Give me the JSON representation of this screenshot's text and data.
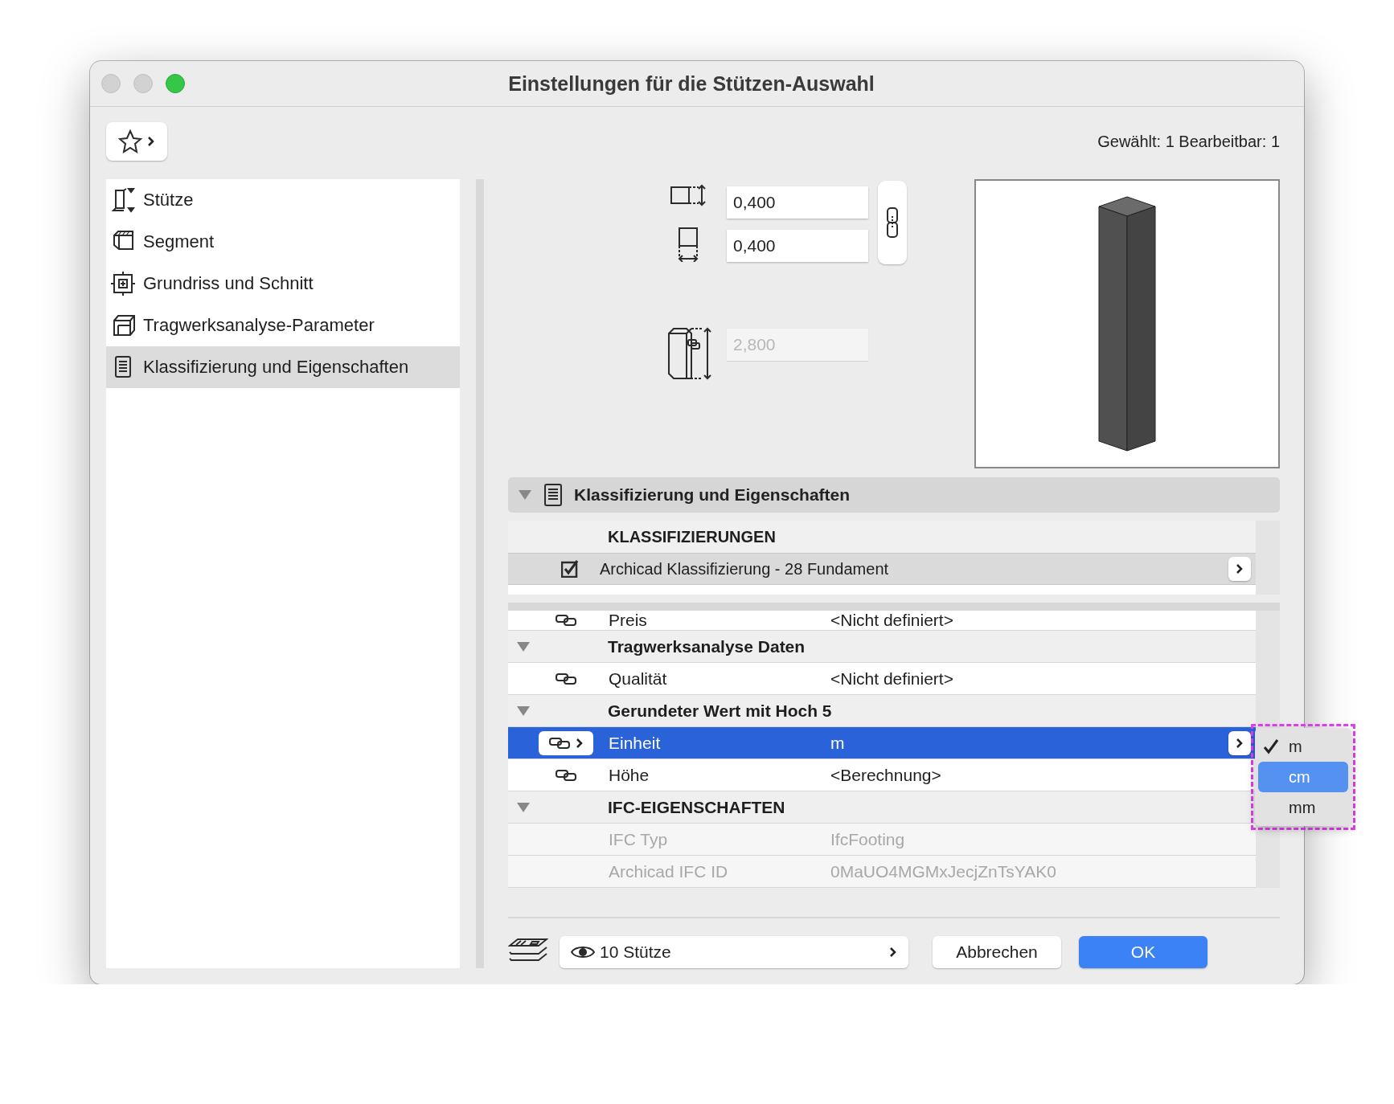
{
  "window": {
    "title": "Einstellungen für die Stützen-Auswahl"
  },
  "selection_info": "Gewählt: 1 Bearbeitbar: 1",
  "sidebar": {
    "items": [
      {
        "label": "Stütze",
        "selected": false
      },
      {
        "label": "Segment",
        "selected": false
      },
      {
        "label": "Grundriss und Schnitt",
        "selected": false
      },
      {
        "label": "Tragwerksanalyse-Parameter",
        "selected": false
      },
      {
        "label": "Klassifizierung und Eigenschaften",
        "selected": true
      }
    ]
  },
  "geometry": {
    "fields": [
      {
        "value": "0,400",
        "disabled": false
      },
      {
        "value": "0,400",
        "disabled": false
      },
      {
        "value": "2,800",
        "disabled": true
      }
    ],
    "linked": true
  },
  "section": {
    "title": "Klassifizierung und Eigenschaften",
    "expanded": true
  },
  "classifications": {
    "heading": "KLASSIFIZIERUNGEN",
    "rows": [
      {
        "label": "Archicad Klassifizierung - 28 Fundament",
        "checked": true
      }
    ]
  },
  "properties": [
    {
      "kind": "property",
      "name": "Preis",
      "value": "<Nicht definiert>",
      "selected": false,
      "disabled": false,
      "linked": true
    },
    {
      "kind": "group",
      "name": "Tragwerksanalyse Daten",
      "expanded": true
    },
    {
      "kind": "property",
      "name": "Qualität",
      "value": "<Nicht definiert>",
      "selected": false,
      "disabled": false,
      "linked": true
    },
    {
      "kind": "group",
      "name": "Gerundeter Wert mit Hoch 5",
      "expanded": true
    },
    {
      "kind": "property",
      "name": "Einheit",
      "value": "m",
      "selected": true,
      "disabled": false,
      "linked": true
    },
    {
      "kind": "property",
      "name": "Höhe",
      "value": "<Berechnung>",
      "selected": false,
      "disabled": false,
      "linked": true
    },
    {
      "kind": "group",
      "name": "IFC-EIGENSCHAFTEN",
      "expanded": true
    },
    {
      "kind": "property",
      "name": "IFC Typ",
      "value": "IfcFooting",
      "selected": false,
      "disabled": true,
      "linked": false
    },
    {
      "kind": "property",
      "name": "Archicad IFC ID",
      "value": "0MaUO4MGMxJecjZnTsYAK0",
      "selected": false,
      "disabled": true,
      "linked": false
    }
  ],
  "popup_menu": {
    "options": [
      {
        "label": "m",
        "checked": true,
        "selected": false
      },
      {
        "label": "cm",
        "checked": false,
        "selected": true
      },
      {
        "label": "mm",
        "checked": false,
        "selected": false
      }
    ]
  },
  "footer": {
    "layer_filter": "10 Stütze",
    "buttons": [
      {
        "label": "Abbrechen",
        "primary": false
      },
      {
        "label": "OK",
        "primary": true
      }
    ]
  }
}
